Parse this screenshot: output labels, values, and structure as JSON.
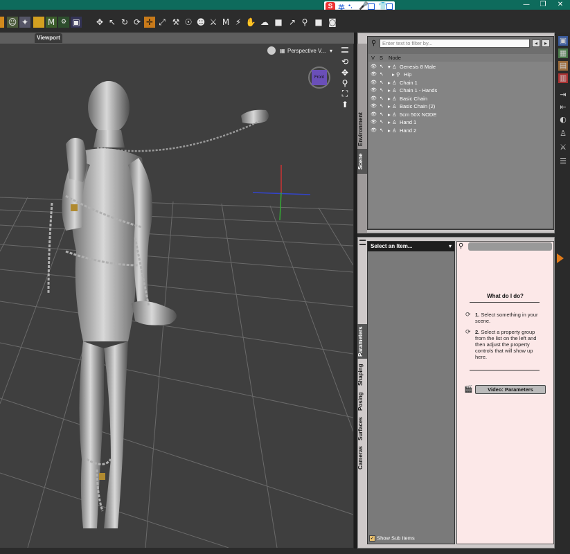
{
  "ime": {
    "logo": "S",
    "lang": "英"
  },
  "window_controls": [
    "—",
    "❐",
    "✕"
  ],
  "toolbar": {
    "icons": [
      "app-icon",
      "figure-icon",
      "pose-icon",
      "folder-icon",
      "m-plus-icon",
      "gear-plus-icon",
      "universal-tool-icon",
      "pointer-icon",
      "rotate-icon",
      "twist-icon",
      "translate-icon",
      "scale-icon",
      "joint-editor-icon",
      "node-weight-icon",
      "active-pose-icon",
      "powerpose-icon",
      "surface-icon",
      "geometry-editor-icon",
      "region-icon",
      "spot-render-icon",
      "node-icon",
      "render-icon",
      "camera-icon"
    ]
  },
  "viewport": {
    "tab_label": "Viewport",
    "camera_label": "Perspective V...",
    "view_cube_label": "Front"
  },
  "scene": {
    "tabs": [
      "Environment",
      "Scene"
    ],
    "filter_placeholder": "Enter text to filter by...",
    "columns": {
      "v": "V",
      "s": "S",
      "node": "Node"
    },
    "nodes": [
      {
        "label": "Genesis 8 Male",
        "depth": 0,
        "expanded": true
      },
      {
        "label": "Hip",
        "depth": 1,
        "expanded": false
      },
      {
        "label": "Chain 1",
        "depth": 0,
        "expanded": false
      },
      {
        "label": "Chain 1 - Hands",
        "depth": 0,
        "expanded": false
      },
      {
        "label": "Basic Chain",
        "depth": 0,
        "expanded": false
      },
      {
        "label": "Basic Chain (2)",
        "depth": 0,
        "expanded": false
      },
      {
        "label": "5cm 50X NODE",
        "depth": 0,
        "expanded": false
      },
      {
        "label": "Hand 1",
        "depth": 0,
        "expanded": false
      },
      {
        "label": "Hand 2",
        "depth": 0,
        "expanded": false
      }
    ]
  },
  "parameters": {
    "tabs": [
      "Parameters",
      "Shaping",
      "Posing",
      "Surfaces",
      "Cameras"
    ],
    "select_label": "Select an Item...",
    "show_sub_items": "Show Sub Items",
    "show_sub_checked": true
  },
  "help": {
    "title": "What do I do?",
    "steps": [
      {
        "num": "1.",
        "text": "Select something in your scene."
      },
      {
        "num": "2.",
        "text": "Select a property group from the list on the left and then adjust the property controls that will show up here."
      }
    ],
    "video_button": "Video: Parameters"
  }
}
